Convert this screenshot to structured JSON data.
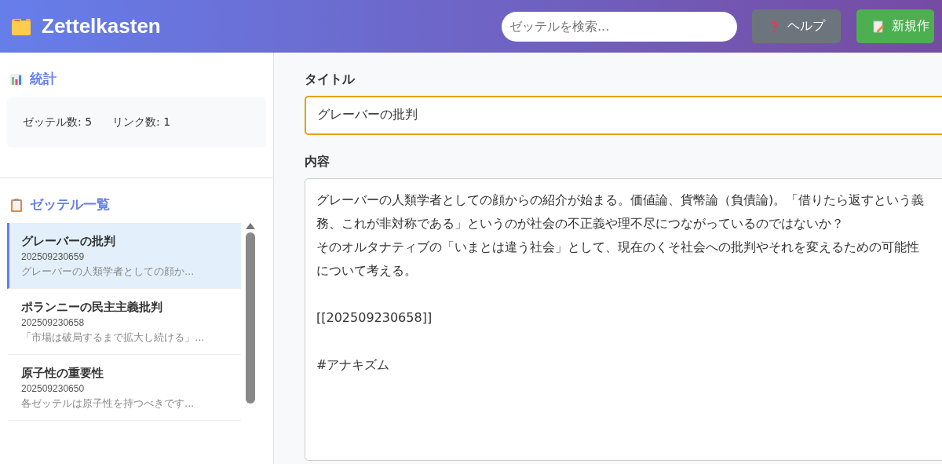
{
  "header": {
    "title": "Zettelkasten",
    "search": {
      "placeholder": "ゼッテルを検索..."
    },
    "buttons": [
      {
        "kind": "help",
        "label": "ヘルプ"
      },
      {
        "kind": "new",
        "label": "新規作"
      }
    ]
  },
  "stats": {
    "heading": "統計",
    "items": [
      "ゼッテル数: 5",
      "リンク数: 1"
    ]
  },
  "list": {
    "heading": "ゼッテル一覧",
    "items": [
      {
        "title": "グレーバーの批判",
        "id": "202509230659",
        "preview": "グレーバーの人類学者としての顔か...",
        "selected": true
      },
      {
        "title": "ポランニーの民主主義批判",
        "id": "202509230658",
        "preview": "「市場は破局するまで拡大し続ける」...",
        "selected": false
      },
      {
        "title": "原子性の重要性",
        "id": "202509230650",
        "preview": "各ゼッテルは原子性を持つべきです...",
        "selected": false
      }
    ]
  },
  "editor": {
    "title_label": "タイトル",
    "title_value": "グレーバーの批判",
    "title_focused": true,
    "content_label": "内容",
    "content": [
      [
        "グレーバーの人類学者としての顔からの紹介が始まる。価値論、貨幣論（負債論)。「借りたら返すという義務、これが非対称である」というのが社会の不正義や理不尽につながっているのではないか？",
        "そのオルタナティブの「いまとは違う社会」として、現在のくそ社会への批判やそれを変えるための可能性について考える。"
      ],
      [
        "[[202509230658]]"
      ],
      [
        "#アナキズム"
      ]
    ]
  }
}
